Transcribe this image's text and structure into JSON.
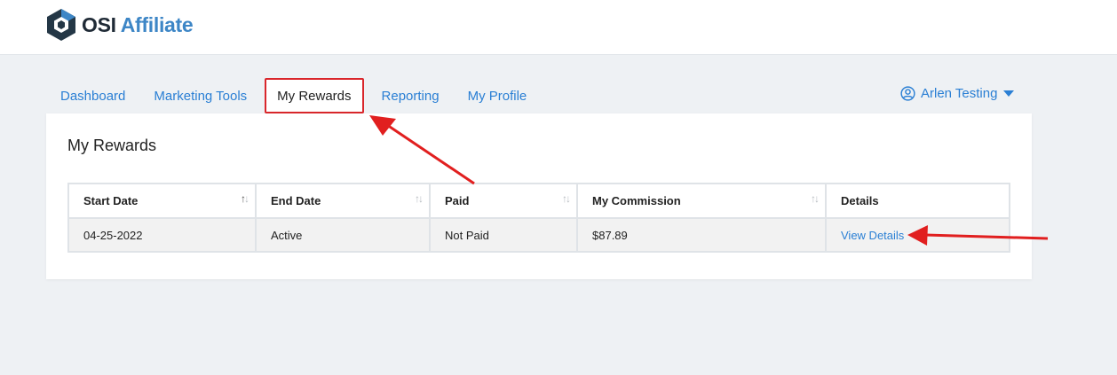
{
  "brand": {
    "name_dark": "OSI",
    "name_light": "Affiliate"
  },
  "nav": {
    "tabs": [
      {
        "label": "Dashboard",
        "active": false
      },
      {
        "label": "Marketing Tools",
        "active": false
      },
      {
        "label": "My Rewards",
        "active": true
      },
      {
        "label": "Reporting",
        "active": false
      },
      {
        "label": "My Profile",
        "active": false
      }
    ],
    "user_name": "Arlen Testing"
  },
  "page": {
    "title": "My Rewards"
  },
  "table": {
    "headers": [
      "Start Date",
      "End Date",
      "Paid",
      "My Commission",
      "Details"
    ],
    "rows": [
      {
        "start_date": "04-25-2022",
        "end_date": "Active",
        "paid": "Not Paid",
        "commission": "$87.89",
        "details_link": "View Details"
      }
    ]
  },
  "colors": {
    "accent": "#2a7fd4",
    "brand_blue": "#3d86c6",
    "annotation_red": "#d9262b"
  }
}
